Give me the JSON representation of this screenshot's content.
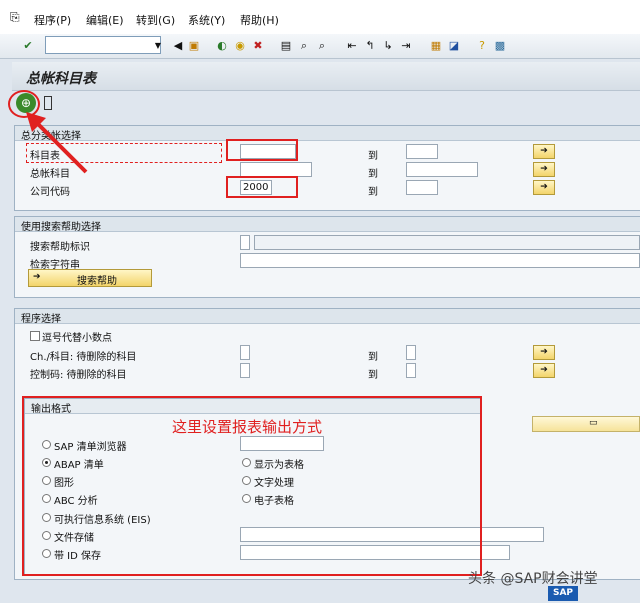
{
  "menu": {
    "items": [
      "程序(P)",
      "编辑(E)",
      "转到(G)",
      "系统(Y)",
      "帮助(H)"
    ]
  },
  "screen": {
    "title": "总帐科目表"
  },
  "group1": {
    "title": "总分类帐选择",
    "rows": [
      {
        "label": "科目表",
        "value": "",
        "to_label": "到"
      },
      {
        "label": "总帐科目",
        "value": "",
        "to_label": "到"
      },
      {
        "label": "公司代码",
        "value": "2000",
        "to_label": "到"
      }
    ]
  },
  "group2": {
    "title": "使用搜索帮助选择",
    "rows": [
      {
        "label": "搜索帮助标识"
      },
      {
        "label": "检索字符串"
      }
    ],
    "button_label": "搜索帮助"
  },
  "group3": {
    "title": "程序选择",
    "checkbox_label": "逗号代替小数点",
    "rows": [
      {
        "label": "Ch./科目: 待删除的科目",
        "to_label": "到"
      },
      {
        "label": "控制码: 待删除的科目",
        "to_label": "到"
      }
    ]
  },
  "group4": {
    "title": "输出格式",
    "options_left": [
      {
        "label": "SAP 清单浏览器",
        "selected": false
      },
      {
        "label": "ABAP 清单",
        "selected": true
      },
      {
        "label": "图形",
        "selected": false
      },
      {
        "label": "ABC 分析",
        "selected": false
      },
      {
        "label": "可执行信息系统 (EIS)",
        "selected": false
      },
      {
        "label": "文件存储",
        "selected": false
      },
      {
        "label": "带 ID 保存",
        "selected": false
      }
    ],
    "options_right": [
      {
        "label": "显示为表格",
        "selected": false
      },
      {
        "label": "文字处理",
        "selected": false
      },
      {
        "label": "电子表格",
        "selected": false
      }
    ]
  },
  "annotation": {
    "text": "这里设置报表输出方式",
    "color": "#e02020"
  },
  "watermark": {
    "text": "头条 @SAP财会讲堂",
    "logo": "SAP"
  },
  "icons": [
    "menu-icon",
    "enter-icon",
    "back-icon",
    "save-icon",
    "exit-icon",
    "cancel-icon",
    "print-icon",
    "find-icon",
    "page-icon",
    "new-session-icon",
    "shortcut-icon",
    "help-icon",
    "settings-icon",
    "execute-icon"
  ]
}
